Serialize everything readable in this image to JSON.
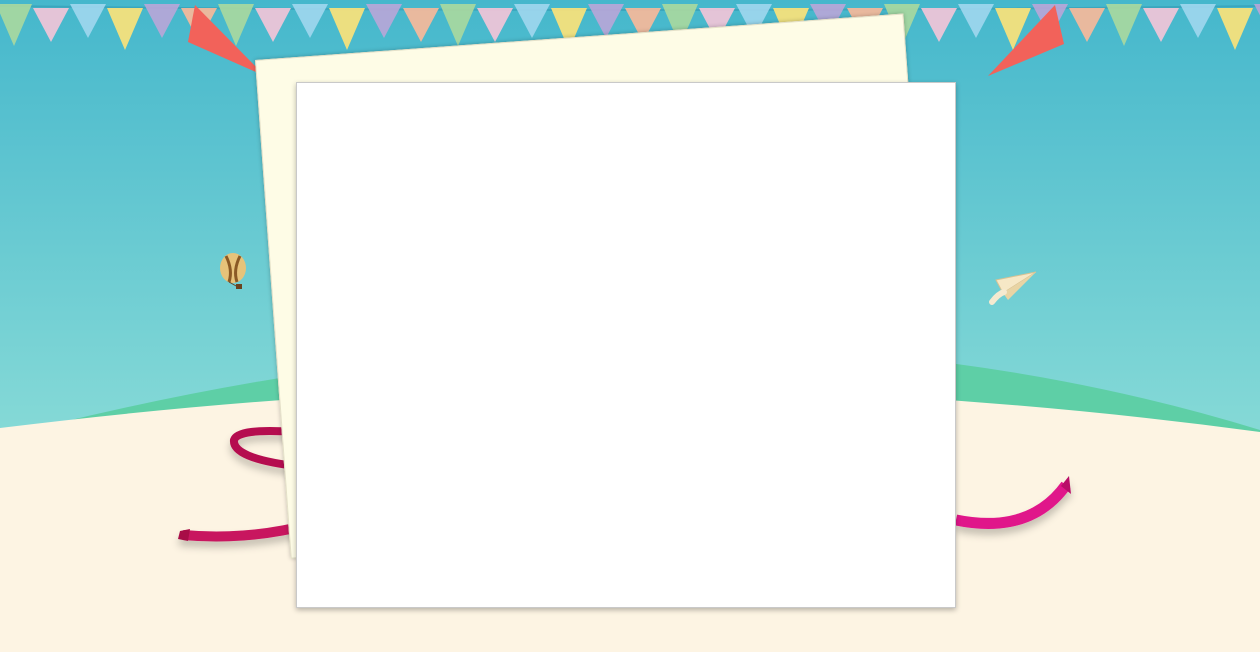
{
  "theme": {
    "sky_top": "#45b7cc",
    "sky_bottom": "#a6ebdc",
    "hill": "#5ecfa6",
    "ground": "#fdf4e3",
    "ribbon": "#c8145e",
    "card": "#ffffff",
    "paper": "#fefce6"
  },
  "bunting": {
    "colors": [
      "#a8d8a0",
      "#f2c4d8",
      "#9ed6ee",
      "#fbe27a",
      "#b7a6d8",
      "#f7b89a"
    ]
  },
  "decorations": [
    "hot-air-balloon-icon",
    "paper-plane-icon",
    "red-streamer-left",
    "red-streamer-right",
    "pink-ribbon"
  ]
}
